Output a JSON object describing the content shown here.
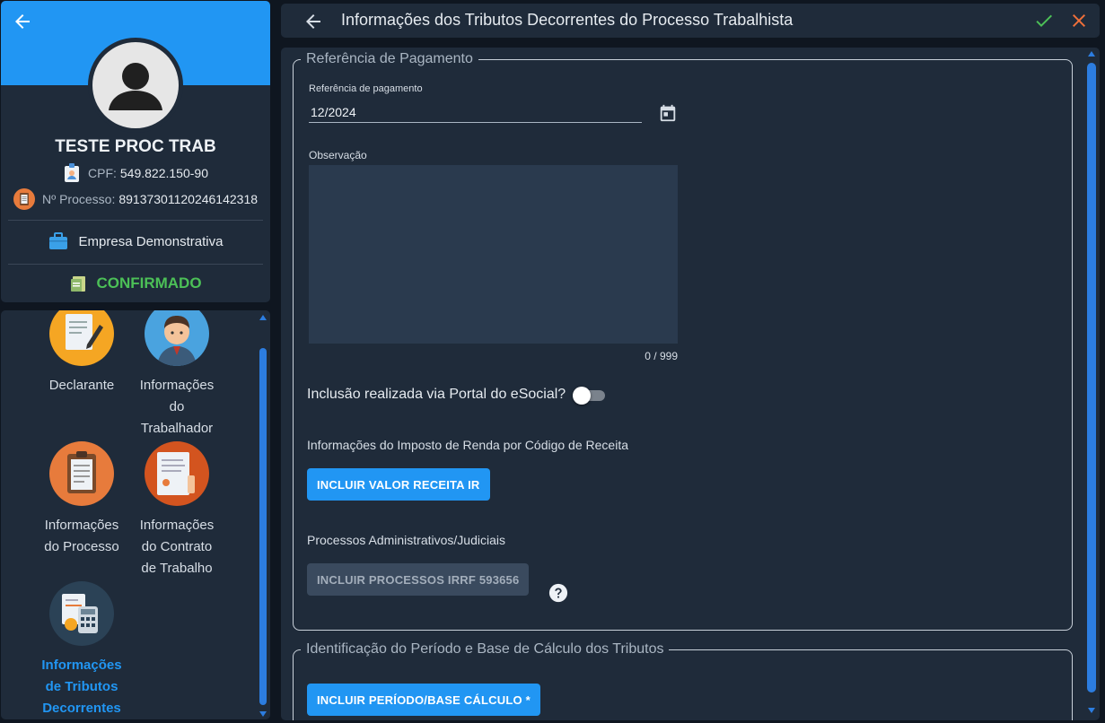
{
  "profile": {
    "name": "TESTE PROC TRAB",
    "cpf_label": "CPF:",
    "cpf_value": "549.822.150-90",
    "process_label": "Nº Processo:",
    "process_value": "89137301120246142318",
    "company": "Empresa Demonstrativa",
    "status": "CONFIRMADO",
    "banner_color": "#2196f3",
    "status_color": "#4cc057"
  },
  "nav": {
    "items": [
      {
        "label": "Declarante",
        "icon": "declarant-icon"
      },
      {
        "label": "Informações do Trabalhador",
        "icon": "worker-icon"
      },
      {
        "label": "Informações do Processo",
        "icon": "process-clipboard-icon"
      },
      {
        "label": "Informações do Contrato de Trabalho",
        "icon": "contract-icon"
      },
      {
        "label": "Informações de Tributos Decorrentes",
        "icon": "tax-calculator-icon",
        "active": true
      }
    ],
    "label_1a": "Informações",
    "label_1b": "do",
    "label_1c": "Trabalhador",
    "label_2a": "Informações",
    "label_2b": "do Processo",
    "label_3a": "Informações",
    "label_3b": "do Contrato",
    "label_3c": "de Trabalho",
    "label_4a": "Informações",
    "label_4b": "de Tributos",
    "label_4c": "Decorrentes"
  },
  "header": {
    "title": "Informações dos Tributos Decorrentes do Processo Trabalhista"
  },
  "payment_section": {
    "legend": "Referência de Pagamento",
    "ref_label": "Referência de pagamento",
    "ref_value": "12/2024",
    "obs_label": "Observação",
    "obs_value": "",
    "counter": "0 / 999",
    "toggle_label": "Inclusão realizada via Portal do eSocial?",
    "toggle_on": false,
    "ir_text": "Informações do Imposto de Renda por Código de Receita",
    "ir_button": "INCLUIR VALOR RECEITA IR",
    "proc_text": "Processos Administrativos/Judiciais",
    "proc_button": "INCLUIR PROCESSOS IRRF 593656"
  },
  "period_section": {
    "legend": "Identificação do Período e Base de Cálculo dos Tributos",
    "button": "INCLUIR PERÍODO/BASE CÁLCULO *"
  },
  "colors": {
    "accent": "#2196f3",
    "panel": "#1f2b3a",
    "confirm": "#4cc057",
    "cancel": "#f0703a"
  }
}
